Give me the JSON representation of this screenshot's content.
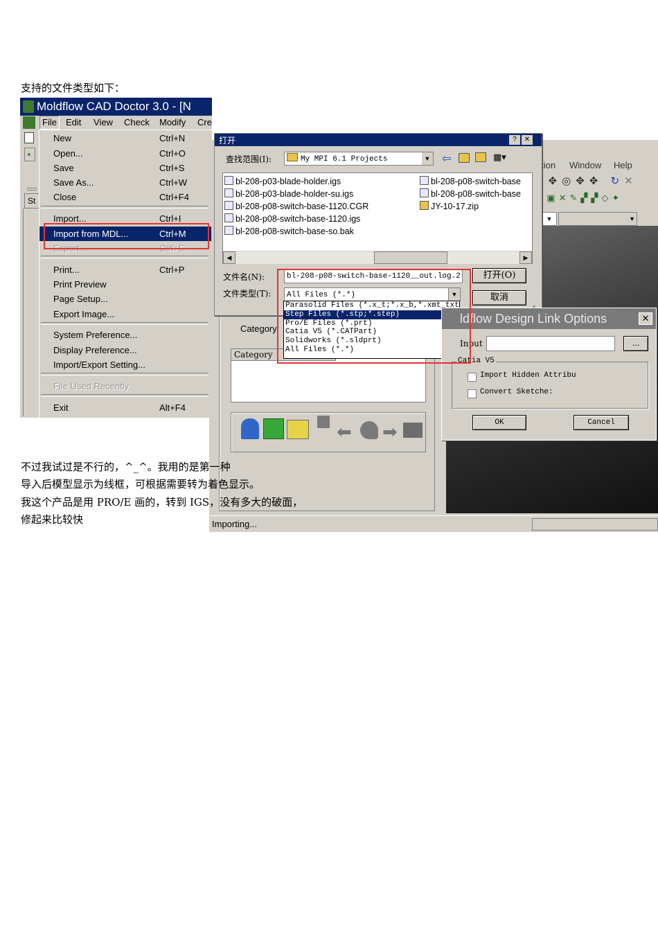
{
  "doc": {
    "heading": "支持的文件类型如下：",
    "lines": [
      "不过我试过是不行的，^_^。我用的是第一种",
      "导入后模型显示为线框，可根据需要转为着色显示。",
      "我这个产品是用 PRO/E 画的，转到 IGS，没有多大的破面，",
      "修起来比较快"
    ]
  },
  "cad_window": {
    "title": "Moldflow CAD Doctor 3.0 - [N",
    "menubar": [
      "File",
      "Edit",
      "View",
      "Check",
      "Modify",
      "Cre"
    ],
    "file_menu": [
      {
        "label": "New",
        "shortcut": "Ctrl+N"
      },
      {
        "label": "Open...",
        "shortcut": "Ctrl+O"
      },
      {
        "label": "Save",
        "shortcut": "Ctrl+S"
      },
      {
        "label": "Save As...",
        "shortcut": "Ctrl+W"
      },
      {
        "label": "Close",
        "shortcut": "Ctrl+F4"
      },
      {
        "label": "Import...",
        "shortcut": "Ctrl+I"
      },
      {
        "label": "Import from MDL...",
        "shortcut": "Ctrl+M"
      },
      {
        "label": "Export...",
        "shortcut": "Ctrl+E"
      },
      {
        "label": "Print...",
        "shortcut": "Ctrl+P"
      },
      {
        "label": "Print Preview",
        "shortcut": ""
      },
      {
        "label": "Page Setup...",
        "shortcut": ""
      },
      {
        "label": "Export Image...",
        "shortcut": ""
      },
      {
        "label": "System Preference...",
        "shortcut": ""
      },
      {
        "label": "Display Preference...",
        "shortcut": ""
      },
      {
        "label": "Import/Export Setting...",
        "shortcut": ""
      },
      {
        "label": "File Used Recently",
        "shortcut": ""
      },
      {
        "label": "Exit",
        "shortcut": "Alt+F4"
      }
    ],
    "side_label": "St"
  },
  "main_window": {
    "menu_tail": [
      "ation",
      "Window",
      "Help"
    ],
    "category_label": "Category",
    "category_header": "Category",
    "status": "Importing..."
  },
  "file_dialog": {
    "title": "打开",
    "look_in_label": "查找范围(I):",
    "look_in_value": "My MPI 6.1 Projects",
    "files": [
      "bl-208-p03-blade-holder.igs",
      "bl-208-p03-blade-holder-su.igs",
      "bl-208-p08-switch-base-1120.CGR",
      "bl-208-p08-switch-base-1120.igs",
      "bl-208-p08-switch-base-so.bak",
      "bl-208-p08-switch-base",
      "bl-208-p08-switch-base",
      "JY-10-17.zip"
    ],
    "filename_label": "文件名(N):",
    "filename_value": "bl-208-p08-switch-base-1120__out.log.2",
    "filetype_label": "文件类型(T):",
    "filetype_value": "All Files (*.*)",
    "open_button": "打开(O)",
    "cancel_button": "取消",
    "type_options": [
      "Parasolid Files (*.x_t;*.x_b,*.xmt_txt,*",
      "Step Files (*.stp;*.step)",
      "Pro/E Files (*.prt)",
      "Catia V5 (*.CATPart)",
      "Solidworks (*.sldprt)",
      "All Files (*.*)"
    ]
  },
  "options_dialog": {
    "title": "ldflow Design Link Options",
    "input_label": "Input",
    "browse_button": "...",
    "group_label": "Catia V5",
    "import_hidden": "Import Hidden Attribu",
    "convert_sketches": "Convert Sketche:",
    "ok_button": "OK",
    "cancel_button": "Cancel"
  }
}
